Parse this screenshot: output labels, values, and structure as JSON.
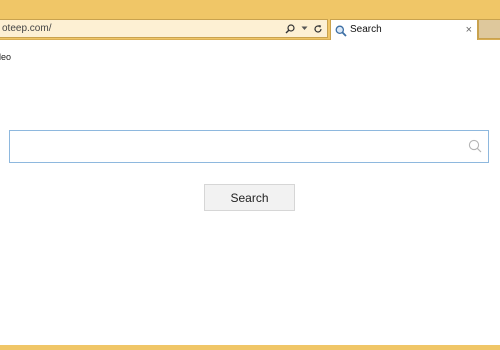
{
  "browser": {
    "address": {
      "url_text": "oteep.com/"
    },
    "tab": {
      "title": "Search",
      "close_glyph": "×",
      "favicon": "search-icon"
    },
    "icons": {
      "address_search": "search-icon",
      "dropdown": "chevron-down-icon",
      "refresh": "refresh-icon"
    },
    "colors": {
      "chrome": "#f0c667",
      "address_bg": "#fdf0d3"
    }
  },
  "page": {
    "nav_link": "deo",
    "search": {
      "value": "",
      "placeholder": "",
      "icon": "search-icon",
      "button_label": "Search"
    },
    "colors": {
      "search_border": "#8eb8de",
      "button_bg": "#f2f2f2"
    }
  }
}
